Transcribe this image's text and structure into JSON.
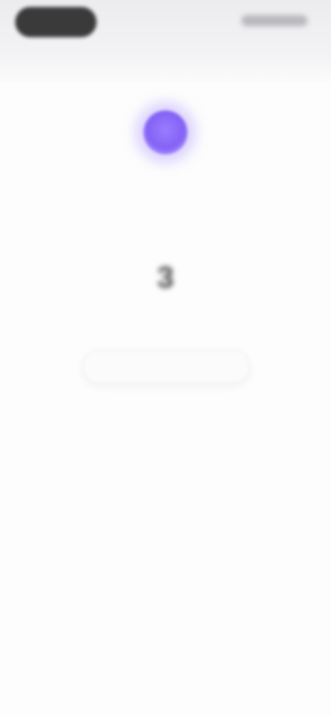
{
  "status_bar": {
    "pill_label": "",
    "right_indicators": ""
  },
  "header": {
    "title": ""
  },
  "main": {
    "top_label": "",
    "value": "3",
    "bottom_label": "",
    "action_label": ""
  },
  "colors": {
    "accent": "#8462f5",
    "background": "#fdfdfd",
    "header_background": "#ececef"
  },
  "icons": {
    "orb": "voice-orb-icon"
  }
}
